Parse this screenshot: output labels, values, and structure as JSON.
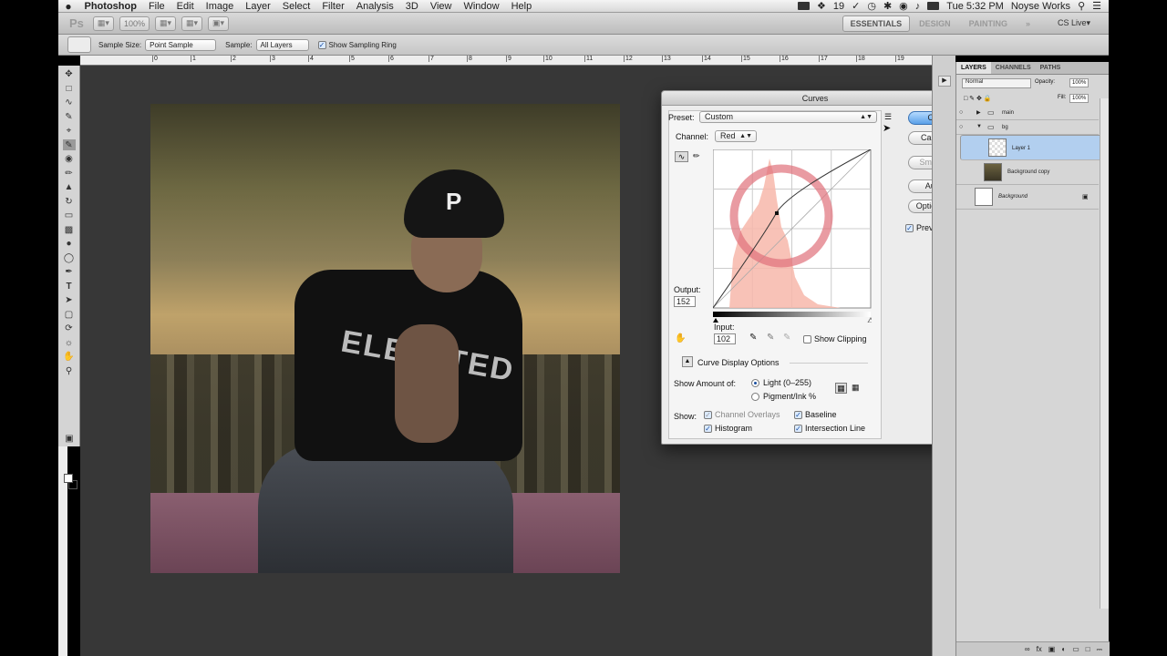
{
  "menubar": {
    "app": "Photoshop",
    "items": [
      "File",
      "Edit",
      "Image",
      "Layer",
      "Select",
      "Filter",
      "Analysis",
      "3D",
      "View",
      "Window",
      "Help"
    ],
    "status_num": "19",
    "clock": "Tue 5:32 PM",
    "user": "Noyse Works"
  },
  "appbar": {
    "logo": "Ps",
    "zoom": "100%",
    "workspaces": [
      "ESSENTIALS",
      "DESIGN",
      "PAINTING"
    ],
    "more": "»",
    "cslive": "CS Live▾"
  },
  "options": {
    "sample_size_label": "Sample Size:",
    "sample_size_value": "Point Sample",
    "sample_label": "Sample:",
    "sample_value": "All Layers",
    "sampling_ring_label": "Show Sampling Ring"
  },
  "ruler": {
    "ticks": [
      [
        "0",
        "167"
      ],
      [
        "1",
        "209"
      ],
      [
        "2",
        "253"
      ],
      [
        "3",
        "296"
      ],
      [
        "4",
        "338"
      ],
      [
        "5",
        "383"
      ],
      [
        "6",
        "426"
      ],
      [
        "7",
        "470"
      ],
      [
        "8",
        "512"
      ],
      [
        "9",
        "555"
      ],
      [
        "10",
        "596"
      ],
      [
        "11",
        "641"
      ],
      [
        "12",
        "684"
      ],
      [
        "13",
        "726"
      ],
      [
        "14",
        "770"
      ],
      [
        "15",
        "813"
      ],
      [
        "16",
        "855"
      ],
      [
        "17",
        "898"
      ],
      [
        "18",
        "939"
      ],
      [
        "19",
        "982"
      ],
      [
        "20",
        "1022"
      ]
    ],
    "left_tick": "1",
    "left_tick_x": "124"
  },
  "artwork": {
    "cap_letter": "P",
    "shirt_text": "ELEVATED"
  },
  "curves": {
    "title": "Curves",
    "preset_label": "Preset:",
    "preset_value": "Custom",
    "channel_label": "Channel:",
    "channel_value": "Red",
    "output_label": "Output:",
    "output_value": "152",
    "input_label": "Input:",
    "input_value": "102",
    "show_clipping": "Show Clipping",
    "display_options": "Curve Display Options",
    "show_amount_label": "Show Amount of:",
    "light_option": "Light  (0–255)",
    "pigment_option": "Pigment/Ink %",
    "show_label": "Show:",
    "channel_overlays": "Channel Overlays",
    "baseline": "Baseline",
    "histogram": "Histogram",
    "intersection_line": "Intersection Line",
    "buttons": {
      "ok": "OK",
      "cancel": "Cancel",
      "smooth": "Smooth",
      "auto": "Auto",
      "options": "Options..."
    },
    "preview": "Preview",
    "curve_points": [
      [
        0,
        0
      ],
      [
        102,
        152
      ],
      [
        255,
        255
      ]
    ],
    "accent": "#e0707a"
  },
  "layers": {
    "tabs": [
      "LAYERS",
      "CHANNELS",
      "PATHS"
    ],
    "blend_mode": "Normal",
    "opacity_label": "Opacity:",
    "opacity_value": "100%",
    "fill_label": "Fill:",
    "fill_value": "100%",
    "rows": [
      {
        "name": "main"
      },
      {
        "name": "bg"
      },
      {
        "name": "Layer 1"
      },
      {
        "name": "Background copy"
      },
      {
        "name": "Background"
      }
    ]
  }
}
